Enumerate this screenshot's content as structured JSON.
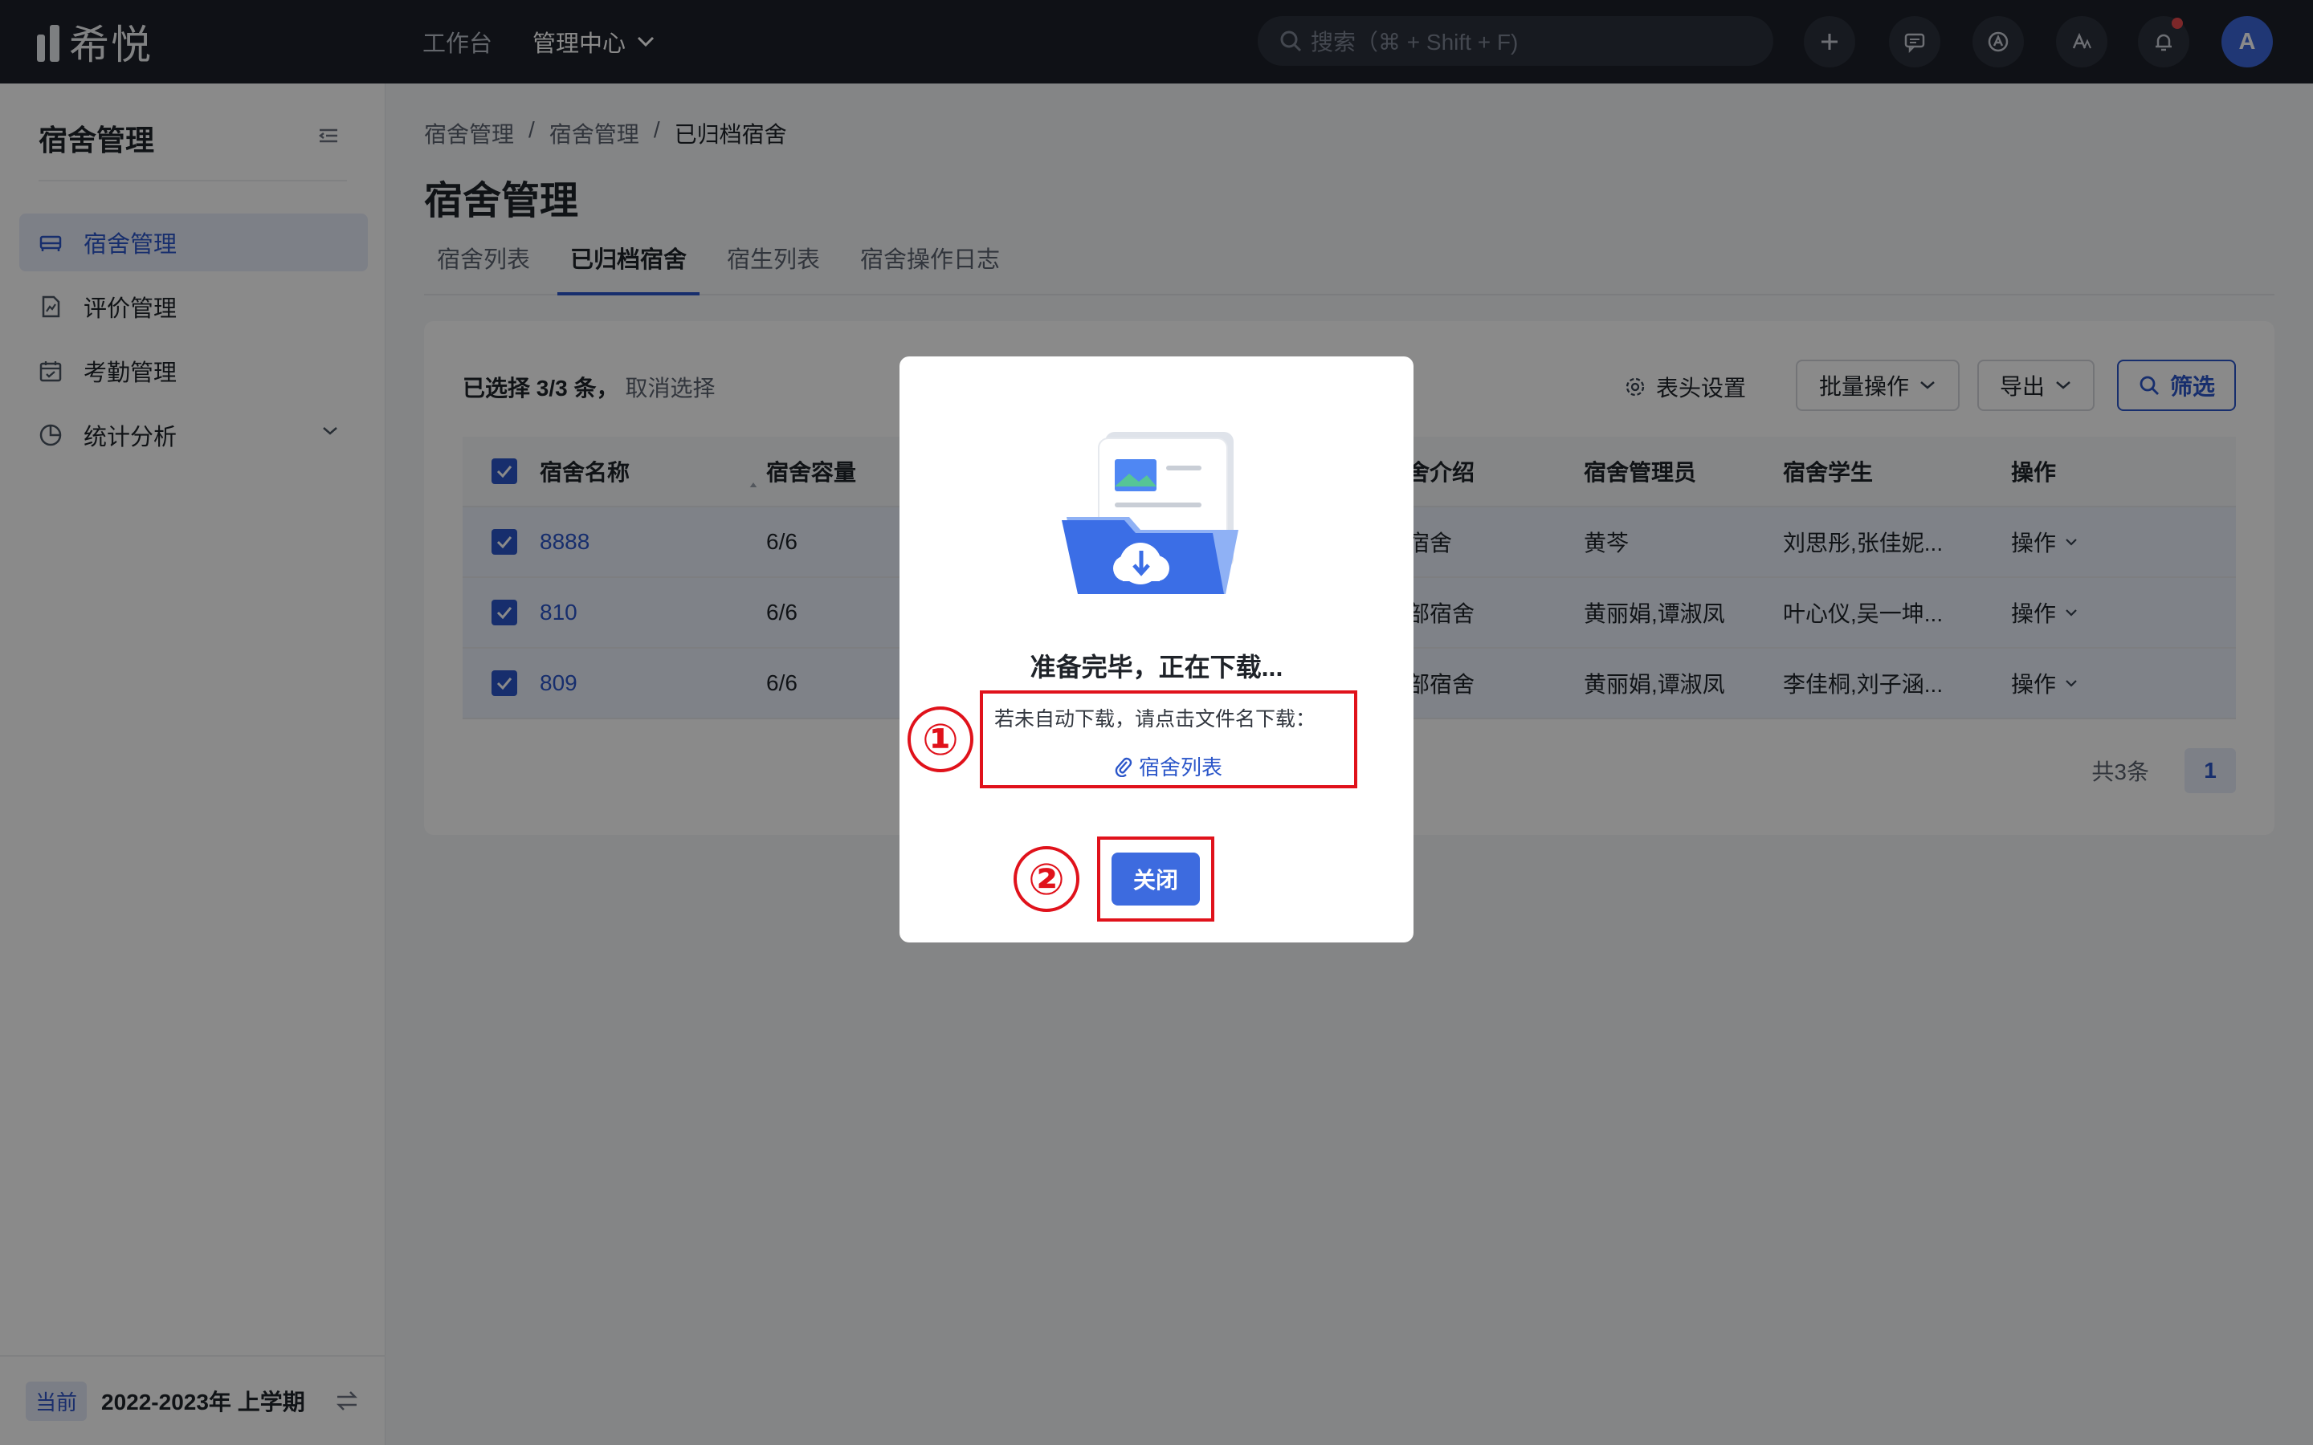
{
  "app": {
    "logo_text": "希悦"
  },
  "topnav": {
    "items": [
      {
        "label": "工作台"
      },
      {
        "label": "管理中心"
      }
    ]
  },
  "search": {
    "placeholder": "搜索（⌘ + Shift + F)"
  },
  "user": {
    "avatar_letter": "A"
  },
  "sidebar": {
    "title": "宿舍管理",
    "items": [
      {
        "label": "宿舍管理"
      },
      {
        "label": "评价管理"
      },
      {
        "label": "考勤管理"
      },
      {
        "label": "统计分析"
      }
    ],
    "footer_badge": "当前",
    "footer_term": "2022-2023年 上学期"
  },
  "breadcrumb": {
    "items": [
      "宿舍管理",
      "宿舍管理",
      "已归档宿舍"
    ],
    "separator": "/"
  },
  "page": {
    "title": "宿舍管理"
  },
  "tabs": [
    {
      "label": "宿舍列表"
    },
    {
      "label": "已归档宿舍"
    },
    {
      "label": "宿生列表"
    },
    {
      "label": "宿舍操作日志"
    }
  ],
  "toolbar": {
    "selection_text": "已选择 3/3 条，",
    "cancel_selection": "取消选择",
    "header_settings": "表头设置",
    "batch_ops": "批量操作",
    "export": "导出",
    "filter": "筛选"
  },
  "table": {
    "columns": [
      "宿舍名称",
      "宿舍容量",
      "宿舍介绍",
      "宿舍管理员",
      "宿舍学生",
      "操作"
    ],
    "rows": [
      {
        "name": "8888",
        "capacity": "6/6",
        "intro": "一宿舍",
        "admin": "黄芩",
        "students": "刘思彤,张佳妮...",
        "op": "操作"
      },
      {
        "name": "810",
        "capacity": "6/6",
        "intro": "年部宿舍",
        "admin": "黄丽娟,谭淑凤",
        "students": "叶心仪,吴一坤...",
        "op": "操作"
      },
      {
        "name": "809",
        "capacity": "6/6",
        "intro": "年部宿舍",
        "admin": "黄丽娟,谭淑凤",
        "students": "李佳桐,刘子涵...",
        "op": "操作"
      }
    ]
  },
  "pagination": {
    "total": "共3条",
    "current": "1"
  },
  "modal": {
    "title": "准备完毕，正在下载...",
    "hint": "若未自动下载，请点击文件名下载：",
    "file_link": "宿舍列表",
    "close_label": "关闭"
  },
  "annotations": {
    "one": "①",
    "two": "②"
  },
  "colors": {
    "primary": "#2b56c9",
    "annotation": "#e0121b",
    "topbar": "#1c2029"
  }
}
